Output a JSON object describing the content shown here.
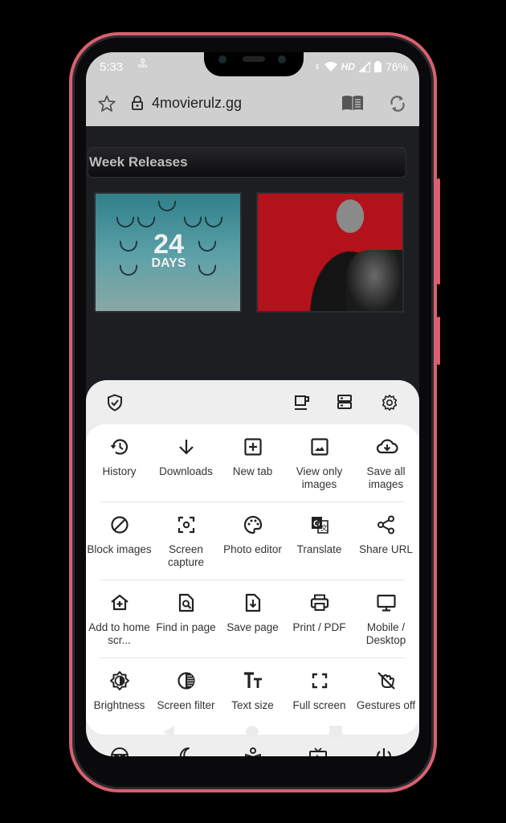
{
  "status_bar": {
    "time": "5:33",
    "net_speed_value": "0",
    "net_speed_unit": "KB/s",
    "network_label": "HD",
    "battery": "76%"
  },
  "url_bar": {
    "url": "4movierulz.gg",
    "icons": [
      "star-icon",
      "lock-icon",
      "reader-mode-icon",
      "reload-icon"
    ]
  },
  "page": {
    "section_title": "Week Releases",
    "posters": [
      {
        "title_line1": "24",
        "title_line2": "DAYS",
        "accent": "#2f7f8a"
      },
      {
        "title_line1": "",
        "title_line2": "",
        "accent": "#b4121a"
      }
    ]
  },
  "menu": {
    "top_icons": [
      "shield-check-icon",
      "coffee-icon",
      "tabs-layout-icon",
      "settings-icon"
    ],
    "rows": [
      [
        {
          "label": "History",
          "icon": "history-icon"
        },
        {
          "label": "Downloads",
          "icon": "download-icon"
        },
        {
          "label": "New tab",
          "icon": "new-tab-icon"
        },
        {
          "label": "View only images",
          "icon": "image-icon"
        },
        {
          "label": "Save all images",
          "icon": "cloud-download-icon"
        }
      ],
      [
        {
          "label": "Block images",
          "icon": "block-icon"
        },
        {
          "label": "Screen capture",
          "icon": "screen-capture-icon"
        },
        {
          "label": "Photo editor",
          "icon": "palette-icon"
        },
        {
          "label": "Translate",
          "icon": "translate-icon"
        },
        {
          "label": "Share URL",
          "icon": "share-icon"
        }
      ],
      [
        {
          "label": "Add to home scr...",
          "icon": "add-home-icon"
        },
        {
          "label": "Find in page",
          "icon": "find-in-page-icon"
        },
        {
          "label": "Save page",
          "icon": "save-page-icon"
        },
        {
          "label": "Print / PDF",
          "icon": "print-icon"
        },
        {
          "label": "Mobile / Desktop",
          "icon": "desktop-icon"
        }
      ],
      [
        {
          "label": "Brightness",
          "icon": "brightness-icon"
        },
        {
          "label": "Screen filter",
          "icon": "screen-filter-icon"
        },
        {
          "label": "Text size",
          "icon": "text-size-icon"
        },
        {
          "label": "Full screen",
          "icon": "fullscreen-icon"
        },
        {
          "label": "Gestures off",
          "icon": "gestures-off-icon"
        }
      ]
    ],
    "bottom_icons": [
      "incognito-icon",
      "night-mode-icon",
      "reading-mode-icon",
      "video-icon",
      "power-icon"
    ]
  },
  "nav_bar": {
    "buttons": [
      "back-button",
      "home-button",
      "recents-button"
    ]
  },
  "colors": {
    "phone_frame": "#d9606e",
    "screen_chrome": "#cfcfcf",
    "page_bg": "#1d1e22",
    "menu_bg": "#eeeeee",
    "menu_card": "#ffffff"
  }
}
